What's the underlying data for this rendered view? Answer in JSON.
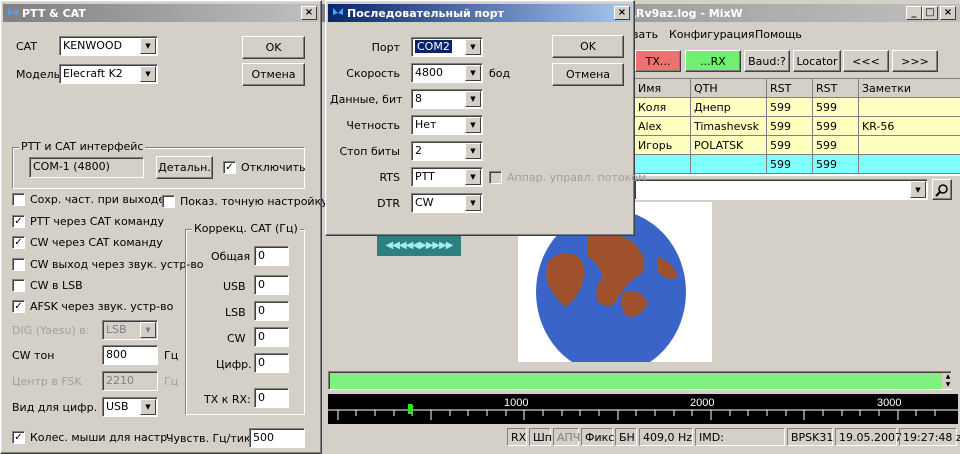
{
  "main": {
    "title": "\\Rv9az.log - MixW",
    "menu": [
      "вать",
      "Конфигурация",
      "Помощь"
    ],
    "toolbar": [
      "TX...",
      "...RX",
      "Baud:?",
      "Locator",
      "<<<",
      ">>>"
    ],
    "colors": {
      "tx": "#f07070",
      "rx": "#70f070",
      "log_row": "#ffffc0",
      "log_row_new": "#80ffff",
      "tune_bar": "#80f080"
    },
    "log": {
      "headers": [
        "Имя",
        "QTH",
        "RST",
        "RST",
        "Заметки"
      ],
      "rows": [
        [
          "Коля",
          "Днепр",
          "599",
          "599",
          ""
        ],
        [
          "Alex",
          "Timashevsk",
          "599",
          "599",
          "KR-56"
        ],
        [
          "Игорь",
          "POLATSK",
          "599",
          "599",
          ""
        ],
        [
          "",
          "",
          "599",
          "599",
          ""
        ]
      ]
    },
    "waterfall": {
      "ticks": [
        "1000",
        "2000",
        "3000"
      ]
    },
    "status": [
      "RX",
      "Шп",
      "АПЧ",
      "Фикс",
      "БН",
      "409,0 Hz",
      "IMD:",
      "BPSK31",
      "19.05.2007",
      "19:27:48 z"
    ]
  },
  "ptt": {
    "title": "PTT & CAT",
    "cat_label": "CAT",
    "cat_value": "KENWOOD",
    "model_label": "Модель",
    "model_value": "Elecraft K2",
    "ok": "OK",
    "cancel": "Отмена",
    "group_title": "PTT и CAT интерфейс",
    "port_value": "COM-1 (4800)",
    "details": "Детальн.",
    "disable": "Отключить",
    "checks": [
      {
        "label": "Сохр. част. при выходе",
        "checked": false
      },
      {
        "label": "PTT через CAT команду",
        "checked": true
      },
      {
        "label": "CW через CAT команду",
        "checked": true
      },
      {
        "label": "CW выход через звук. устр-во",
        "checked": false
      },
      {
        "label": "CW в LSB",
        "checked": false
      },
      {
        "label": "AFSK через звук. устр-во",
        "checked": true
      }
    ],
    "exact_tune": "Показ. точную настройку",
    "dig_label": "DIG (Yaesu) в:",
    "dig_value": "LSB",
    "cw_tone_label": "CW тон",
    "cw_tone_value": "800",
    "hz1": "Гц",
    "fsk_label": "Центр в FSK",
    "fsk_value": "2210",
    "hz2": "Гц",
    "view_label": "Вид для цифр.",
    "view_value": "USB",
    "wheel_label": "Колес. мыши для настр.",
    "wheel_checked": true,
    "sens_label": "Чувств. Гц/тик",
    "sens_value": "500",
    "corr_title": "Коррекц. CAT (Гц)",
    "corr": [
      {
        "label": "Общая",
        "value": "0"
      },
      {
        "label": "USB",
        "value": "0"
      },
      {
        "label": "LSB",
        "value": "0"
      },
      {
        "label": "CW",
        "value": "0"
      },
      {
        "label": "Цифр.",
        "value": "0"
      },
      {
        "label": "TX к RX:",
        "value": "0"
      }
    ]
  },
  "serial": {
    "title": "Последовательный порт",
    "rows": [
      {
        "label": "Порт",
        "value": "COM2"
      },
      {
        "label": "Скорость",
        "value": "4800"
      },
      {
        "label": "Данные, бит",
        "value": "8"
      },
      {
        "label": "Четность",
        "value": "Нет"
      },
      {
        "label": "Стоп биты",
        "value": "2"
      },
      {
        "label": "RTS",
        "value": "PTT"
      },
      {
        "label": "DTR",
        "value": "CW"
      }
    ],
    "unit": "бод",
    "hw_flow": "Аппар. управл. потоком",
    "ok": "OK",
    "cancel": "Отмена"
  }
}
